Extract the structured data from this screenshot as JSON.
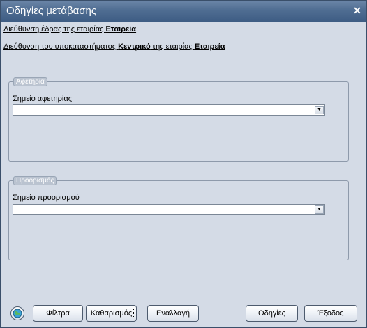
{
  "window": {
    "title": "Οδηγίες μετάβασης"
  },
  "titlebar": {
    "minimize_glyph": "_",
    "close_glyph": "✕"
  },
  "links": {
    "headquarters": {
      "prefix": "Διεύθυνση έδρας της εταιρίας ",
      "company": "Εταιρεία"
    },
    "branch": {
      "prefix": "Διεύθυνση του υποκαταστήματος ",
      "branch_name": "Κεντρικό",
      "middle": " της εταιρίας ",
      "company": "Εταιρεία"
    }
  },
  "start_group": {
    "legend": "Αφετηρία",
    "field_label": "Σημείο αφετηρίας",
    "value": ""
  },
  "dest_group": {
    "legend": "Προορισμός",
    "field_label": "Σημείο προορισμού",
    "value": ""
  },
  "buttons": {
    "filters": "Φίλτρα",
    "clear": "Καθαρισμός",
    "swap": "Εναλλαγή",
    "directions": "Οδηγίες",
    "exit": "Έξοδος"
  },
  "icons": {
    "map": "map-globe-icon"
  },
  "colors": {
    "titlebar": "#4f6d92",
    "body": "#d4dbe6"
  }
}
